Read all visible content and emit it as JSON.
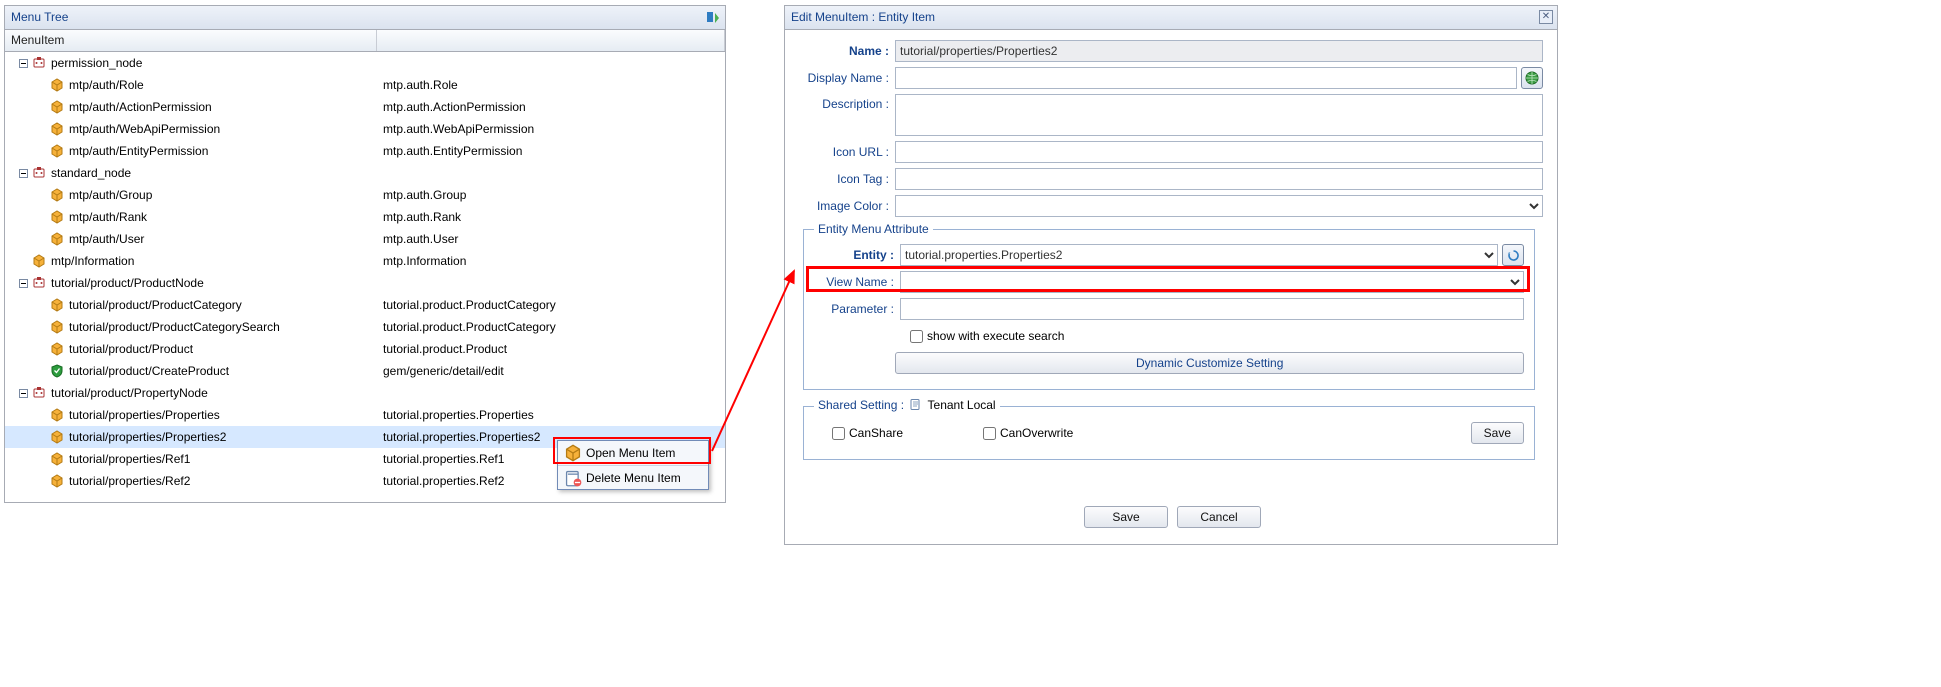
{
  "left_panel": {
    "title": "Menu Tree",
    "col_a": "MenuItem",
    "tree": [
      {
        "type": "node",
        "depth": 0,
        "expanded": true,
        "icon": "node",
        "label": "permission_node",
        "b": ""
      },
      {
        "type": "item",
        "depth": 1,
        "icon": "box",
        "label": "mtp/auth/Role",
        "b": "mtp.auth.Role"
      },
      {
        "type": "item",
        "depth": 1,
        "icon": "box",
        "label": "mtp/auth/ActionPermission",
        "b": "mtp.auth.ActionPermission"
      },
      {
        "type": "item",
        "depth": 1,
        "icon": "box",
        "label": "mtp/auth/WebApiPermission",
        "b": "mtp.auth.WebApiPermission"
      },
      {
        "type": "item",
        "depth": 1,
        "icon": "box",
        "label": "mtp/auth/EntityPermission",
        "b": "mtp.auth.EntityPermission"
      },
      {
        "type": "node",
        "depth": 0,
        "expanded": true,
        "icon": "node",
        "label": "standard_node",
        "b": ""
      },
      {
        "type": "item",
        "depth": 1,
        "icon": "box",
        "label": "mtp/auth/Group",
        "b": "mtp.auth.Group"
      },
      {
        "type": "item",
        "depth": 1,
        "icon": "box",
        "label": "mtp/auth/Rank",
        "b": "mtp.auth.Rank"
      },
      {
        "type": "item",
        "depth": 1,
        "icon": "box",
        "label": "mtp/auth/User",
        "b": "mtp.auth.User"
      },
      {
        "type": "item",
        "depth": 0,
        "icon": "box",
        "label": "mtp/Information",
        "b": "mtp.Information",
        "no_expander": true
      },
      {
        "type": "node",
        "depth": 0,
        "expanded": true,
        "icon": "node",
        "label": "tutorial/product/ProductNode",
        "b": ""
      },
      {
        "type": "item",
        "depth": 1,
        "icon": "box",
        "label": "tutorial/product/ProductCategory",
        "b": "tutorial.product.ProductCategory"
      },
      {
        "type": "item",
        "depth": 1,
        "icon": "box",
        "label": "tutorial/product/ProductCategorySearch",
        "b": "tutorial.product.ProductCategory"
      },
      {
        "type": "item",
        "depth": 1,
        "icon": "box",
        "label": "tutorial/product/Product",
        "b": "tutorial.product.Product"
      },
      {
        "type": "item",
        "depth": 1,
        "icon": "shield",
        "label": "tutorial/product/CreateProduct",
        "b": "gem/generic/detail/edit"
      },
      {
        "type": "node",
        "depth": 0,
        "expanded": true,
        "icon": "node",
        "label": "tutorial/product/PropertyNode",
        "b": ""
      },
      {
        "type": "item",
        "depth": 1,
        "icon": "box",
        "label": "tutorial/properties/Properties",
        "b": "tutorial.properties.Properties"
      },
      {
        "type": "item",
        "depth": 1,
        "icon": "box",
        "label": "tutorial/properties/Properties2",
        "b": "tutorial.properties.Properties2",
        "selected": true
      },
      {
        "type": "item",
        "depth": 1,
        "icon": "box",
        "label": "tutorial/properties/Ref1",
        "b": "tutorial.properties.Ref1"
      },
      {
        "type": "item",
        "depth": 1,
        "icon": "box",
        "label": "tutorial/properties/Ref2",
        "b": "tutorial.properties.Ref2"
      }
    ]
  },
  "context_menu": {
    "open": "Open Menu Item",
    "delete": "Delete Menu Item"
  },
  "right_panel": {
    "title": "Edit MenuItem : Entity Item",
    "labels": {
      "name": "Name :",
      "display_name": "Display Name :",
      "description": "Description :",
      "icon_url": "Icon URL :",
      "icon_tag": "Icon Tag :",
      "image_color": "Image Color :",
      "entity_legend": "Entity Menu Attribute",
      "entity": "Entity :",
      "view_name": "View Name :",
      "parameter": "Parameter :",
      "show_execute": "show with execute search",
      "dynamic": "Dynamic Customize Setting",
      "shared_legend": "Shared Setting :",
      "tenant_local": "Tenant Local",
      "canshare": "CanShare",
      "canoverwrite": "CanOverwrite",
      "save_inner": "Save",
      "save": "Save",
      "cancel": "Cancel"
    },
    "values": {
      "name": "tutorial/properties/Properties2",
      "entity": "tutorial.properties.Properties2"
    }
  }
}
